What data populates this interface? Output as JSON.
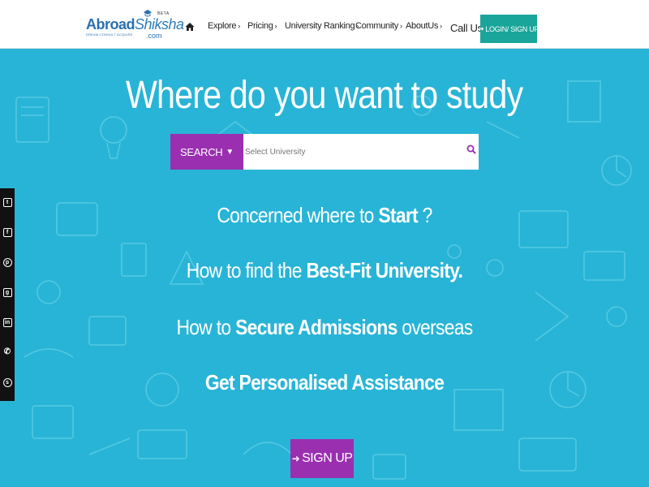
{
  "logo": {
    "name_part1": "Abroad",
    "name_part2": "Shiksha",
    "beta": "BETA",
    "domain": ".com",
    "tagline": "DREAM CONSULT ACQUIRE"
  },
  "nav": {
    "items": [
      {
        "label": "Explore"
      },
      {
        "label": "Pricing"
      },
      {
        "label": "University Ranking"
      },
      {
        "label": "Community"
      },
      {
        "label": "AboutUs"
      }
    ],
    "chevron": "›",
    "call_us": "Call Us",
    "login_label": "LOGIN/ SIGN UP"
  },
  "hero": {
    "title": "Where do you want to study",
    "search": {
      "button_label": "SEARCH",
      "placeholder": "Select University"
    },
    "lines": [
      {
        "pre": "Concerned where to ",
        "bold": "Start",
        "post": " ?"
      },
      {
        "pre": "How to find the ",
        "bold": "Best-Fit University.",
        "post": ""
      },
      {
        "pre": "How to ",
        "bold": "Secure Admissions",
        "post": " overseas"
      },
      {
        "pre": "",
        "bold": "Get Personalised Assistance",
        "post": ""
      }
    ],
    "signup_label": "SIGN UP"
  },
  "social": [
    {
      "icon": "twitter-icon",
      "glyph": "t"
    },
    {
      "icon": "facebook-icon",
      "glyph": "f"
    },
    {
      "icon": "pinterest-icon",
      "glyph": "p"
    },
    {
      "icon": "google-plus-icon",
      "glyph": "g"
    },
    {
      "icon": "linkedin-icon",
      "glyph": "in"
    },
    {
      "icon": "phone-icon",
      "glyph": "✆"
    },
    {
      "icon": "skype-icon",
      "glyph": "s"
    }
  ],
  "colors": {
    "hero_bg": "#28b4d6",
    "purple": "#9a2fb0",
    "login_teal": "#1aa59a",
    "social_bar": "#111111",
    "brand_blue": "#2a6fb0"
  }
}
